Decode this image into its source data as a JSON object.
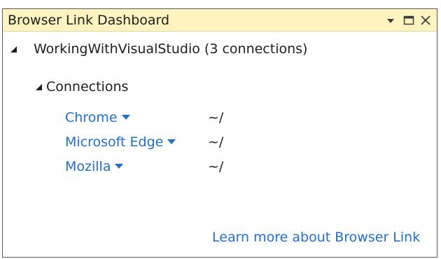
{
  "window": {
    "title": "Browser Link Dashboard"
  },
  "tree": {
    "project": {
      "label": "WorkingWithVisualStudio (3 connections)",
      "expanded": true
    },
    "connections_group": {
      "label": "Connections",
      "expanded": true
    },
    "connections": [
      {
        "browser": "Chrome",
        "path": "~/"
      },
      {
        "browser": "Microsoft Edge",
        "path": "~/"
      },
      {
        "browser": "Mozilla",
        "path": "~/"
      }
    ]
  },
  "footer": {
    "learn_more": "Learn more about Browser Link"
  },
  "colors": {
    "title_bar": "#fdf4bf",
    "link": "#1e6fcf",
    "text": "#1e1e1e"
  }
}
